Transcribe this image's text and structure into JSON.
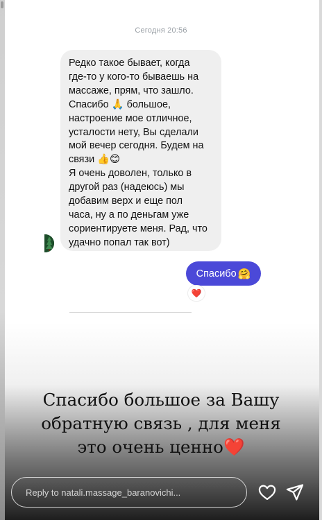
{
  "chat": {
    "timestamp": "Сегодня 20:56",
    "incoming": {
      "lines": [
        "Редко такое бывает, когда",
        "где-то у кого-то бываешь на",
        "массаже, прям, что зашло.",
        "Спасибо 🙏 большое,",
        "настроение мое отличное,",
        "усталости нету, Вы сделали",
        "мой вечер сегодня. Будем на",
        "связи 👍😊",
        "Я очень доволен, только в",
        "другой раз (надеюсь) мы",
        "добавим верх и еще пол",
        "часа, ну а по деньгам уже",
        "сориентируете меня. Рад, что",
        "удачно попал так вот)"
      ]
    },
    "outgoing": {
      "text": "Спасибо",
      "emoji": "🤗"
    },
    "reaction": "❤️"
  },
  "story": {
    "caption_lines": [
      "Спасибо большое за Вашу",
      "обратную связь , для меня",
      "это очень ценно"
    ],
    "caption_emoji": "❤️"
  },
  "reply": {
    "placeholder": "Reply to natali.massage_baranovichi..."
  },
  "icons": {
    "like": "heart-outline-icon",
    "send": "paper-plane-icon"
  },
  "colors": {
    "outgoing_bubble": "#4b49d8",
    "incoming_bubble": "#efefef",
    "caption_heart": "#e02424"
  }
}
